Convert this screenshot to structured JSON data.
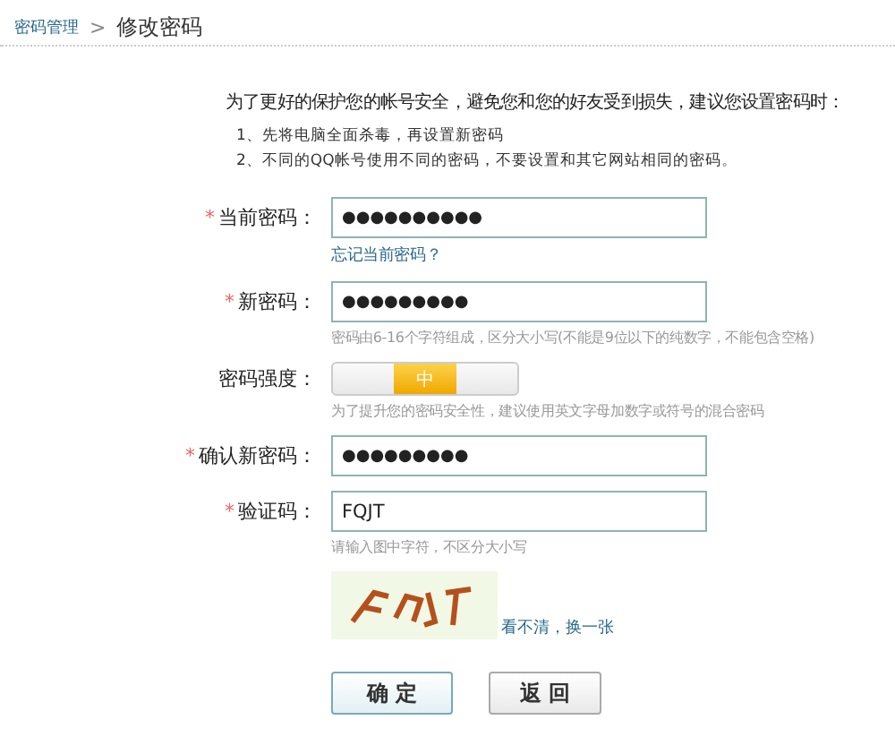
{
  "breadcrumb": {
    "items": [
      "密码管理",
      "修改密码"
    ],
    "separator": ">"
  },
  "intro": "为了更好的保护您的帐号安全，避免您和您的好友受到损失，建议您设置密码时：",
  "tips": [
    "1、先将电脑全面杀毒，再设置新密码",
    "2、不同的QQ帐号使用不同的密码，不要设置和其它网站相同的密码。"
  ],
  "form": {
    "rows": [
      {
        "kind": "field",
        "required_mark": "*",
        "label": "当前密码：",
        "value": "●●●●●●●●●●",
        "link": "忘记当前密码？"
      },
      {
        "kind": "field",
        "required_mark": "*",
        "label": "新密码：",
        "value": "●●●●●●●●●",
        "hint": "密码由6-16个字符组成，区分大小写(不能是9位以下的纯数字，不能包含空格)"
      },
      {
        "kind": "strength",
        "label": "密码强度：",
        "segments": [
          {
            "selected": false
          },
          {
            "label": "中",
            "selected": true
          },
          {
            "selected": false
          }
        ],
        "hint": "为了提升您的密码安全性，建议使用英文字母加数字或符号的混合密码"
      },
      {
        "kind": "field",
        "required_mark": "*",
        "label": "确认新密码：",
        "value": "●●●●●●●●●"
      },
      {
        "kind": "field",
        "required_mark": "*",
        "label": "验证码：",
        "value": "FQJT",
        "hint": "请输入图中字符，不区分大小写"
      },
      {
        "kind": "captcha",
        "refresh": "看不清，换一张"
      }
    ]
  },
  "buttons": [
    {
      "label": "确 定",
      "kind": "primary"
    },
    {
      "label": "返 回",
      "kind": "secondary"
    }
  ]
}
